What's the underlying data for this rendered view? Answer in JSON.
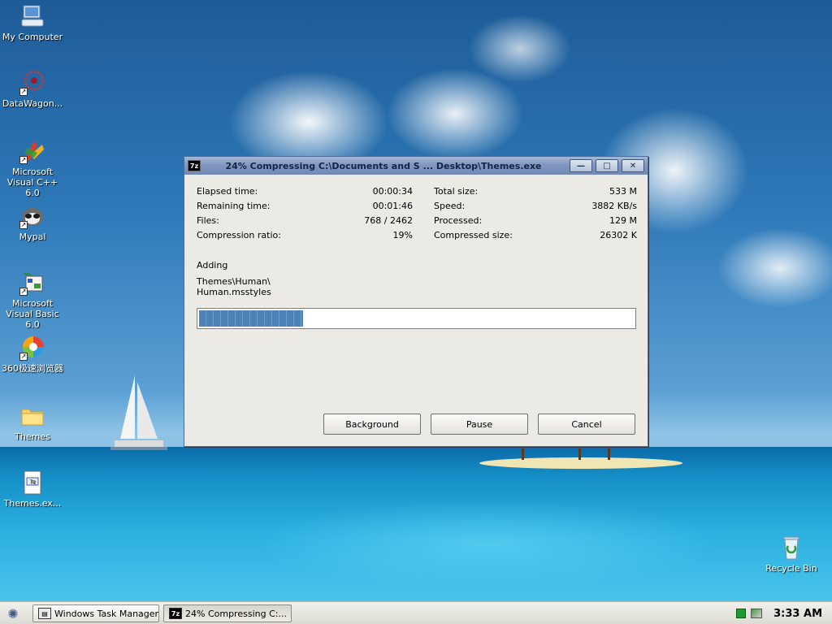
{
  "desktop": {
    "icons": [
      {
        "label": "My Computer",
        "icon": "computer-icon"
      },
      {
        "label": "DataWagon...",
        "icon": "datawagon-icon"
      },
      {
        "label": "Microsoft Visual C++ 6.0",
        "icon": "visual-cpp-icon"
      },
      {
        "label": "Mypal",
        "icon": "mypal-icon"
      },
      {
        "label": "Microsoft Visual Basic 6.0",
        "icon": "visual-basic-icon"
      },
      {
        "label": "360极速浏览器",
        "icon": "360-browser-icon"
      },
      {
        "label": "Themes",
        "icon": "folder-icon"
      },
      {
        "label": "Themes.ex...",
        "icon": "exe-file-icon"
      },
      {
        "label": "Recycle Bin",
        "icon": "recycle-bin-icon"
      }
    ]
  },
  "dialog": {
    "app_badge": "7z",
    "title": "24% Compressing C:\\Documents and S ... Desktop\\Themes.exe",
    "buttons": {
      "minimize": "—",
      "maximize": "□",
      "close": "✕"
    },
    "left_stats": [
      {
        "label": "Elapsed time:",
        "value": "00:00:34"
      },
      {
        "label": "Remaining time:",
        "value": "00:01:46"
      },
      {
        "label": "Files:",
        "value": "768 / 2462"
      },
      {
        "label": "Compression ratio:",
        "value": "19%"
      }
    ],
    "right_stats": [
      {
        "label": "Total size:",
        "value": "533 M"
      },
      {
        "label": "Speed:",
        "value": "3882 KB/s"
      },
      {
        "label": "Processed:",
        "value": "129 M"
      },
      {
        "label": "Compressed size:",
        "value": "26302 K"
      }
    ],
    "status": "Adding",
    "current_file_line1": "Themes\\Human\\",
    "current_file_line2": "Human.msstyles",
    "progress_percent": 24,
    "background_label": "Background",
    "pause_label": "Pause",
    "cancel_label": "Cancel"
  },
  "taskbar": {
    "tasks": [
      {
        "label": "Windows Task Manager",
        "active": false
      },
      {
        "label": "24% Compressing C:...",
        "active": true
      }
    ],
    "clock": "3:33 AM"
  }
}
